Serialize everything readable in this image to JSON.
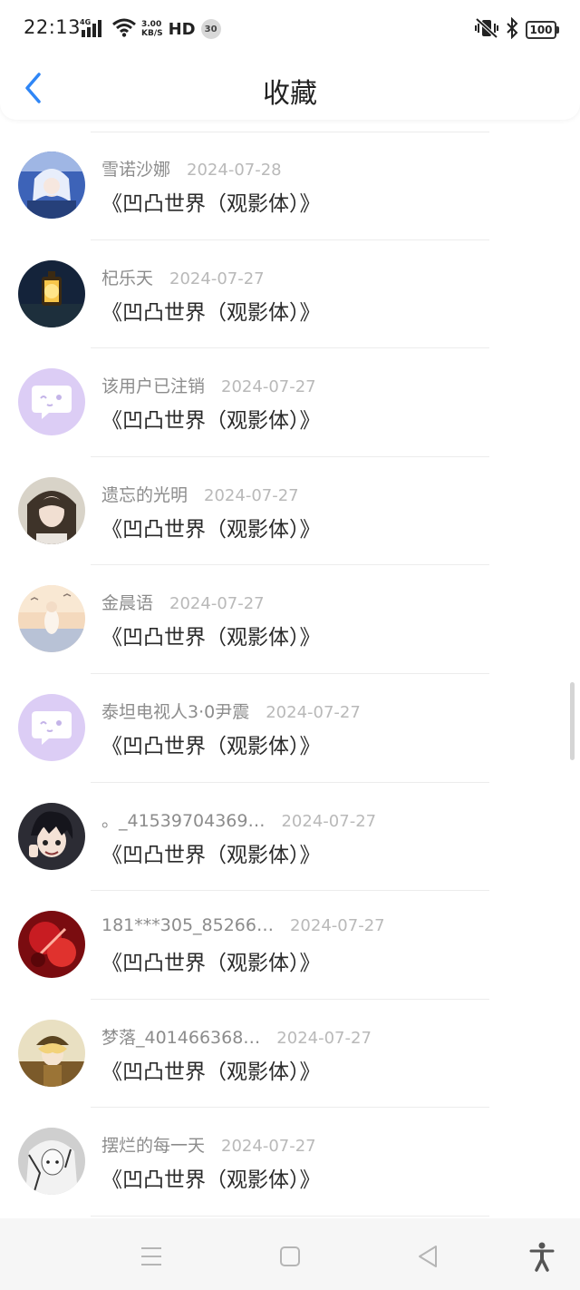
{
  "status_bar": {
    "time": "22:13",
    "network_type": "4G",
    "speed_value": "3.00",
    "speed_unit": "KB/S",
    "hd_label": "HD",
    "notification_count": "30",
    "battery_level": "100"
  },
  "header": {
    "title": "收藏",
    "accent_color": "#2f86f6"
  },
  "favorites": [
    {
      "user": "雪诺沙娜",
      "date": "2024-07-28",
      "title": "《凹凸世界（观影体）》",
      "avatar": "anime-blue-avatar"
    },
    {
      "user": "杞乐天",
      "date": "2024-07-27",
      "title": "《凹凸世界（观影体）》",
      "avatar": "lantern-avatar"
    },
    {
      "user": "该用户已注销",
      "date": "2024-07-27",
      "title": "《凹凸世界（观影体）》",
      "avatar": "default-chat-avatar"
    },
    {
      "user": "遗忘的光明",
      "date": "2024-07-27",
      "title": "《凹凸世界（观影体）》",
      "avatar": "anime-girl-avatar"
    },
    {
      "user": "金晨语",
      "date": "2024-07-27",
      "title": "《凹凸世界（观影体）》",
      "avatar": "sunset-violin-avatar"
    },
    {
      "user": "泰坦电视人3·0尹震",
      "date": "2024-07-27",
      "title": "《凹凸世界（观影体）》",
      "avatar": "default-chat-avatar"
    },
    {
      "user": "。_41539704369…",
      "date": "2024-07-27",
      "title": "《凹凸世界（观影体）》",
      "avatar": "anime-boy-avatar"
    },
    {
      "user": "181***305_85266…",
      "date": "2024-07-27",
      "title": "《凹凸世界（观影体）》",
      "avatar": "red-abstract-avatar"
    },
    {
      "user": "梦落_401466368…",
      "date": "2024-07-27",
      "title": "《凹凸世界（观影体）》",
      "avatar": "anime-hat-avatar"
    },
    {
      "user": "摆烂的每一天",
      "date": "2024-07-27",
      "title": "《凹凸世界（观影体）》",
      "avatar": "sketch-girl-avatar"
    }
  ],
  "bottom_nav": {
    "items": [
      "menu-icon",
      "home-square-icon",
      "back-triangle-icon",
      "accessibility-icon"
    ]
  }
}
